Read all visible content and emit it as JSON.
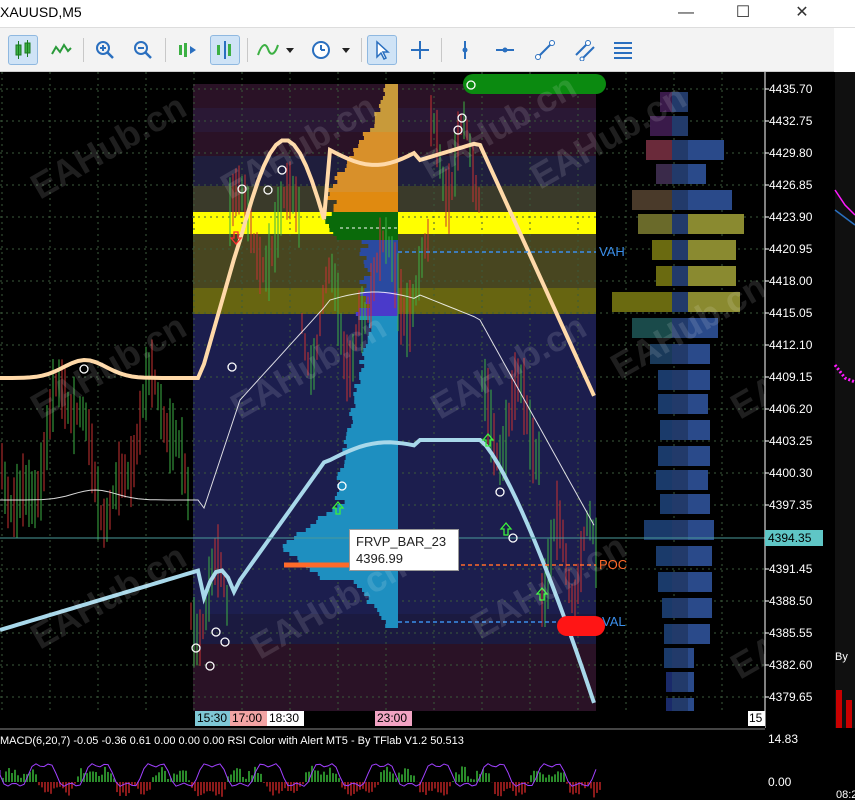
{
  "window": {
    "title": "XAUUSD,M5",
    "controls": {
      "minimize": "—",
      "maximize": "☐",
      "close": "✕"
    }
  },
  "toolbar": {
    "tools": [
      "bar-chart",
      "line-chart",
      "zoom-in",
      "zoom-out",
      "auto-scroll",
      "chart-shift",
      "indicators",
      "periods",
      "cursor",
      "crosshair",
      "vertical-line",
      "horizontal-line",
      "trend-line",
      "equidistant-channel",
      "fibonacci"
    ]
  },
  "price_axis": {
    "ticks": [
      "4435.70",
      "4432.75",
      "4429.80",
      "4426.85",
      "4423.90",
      "4420.95",
      "4418.00",
      "4415.05",
      "4412.10",
      "4409.15",
      "4406.20",
      "4403.25",
      "4400.30",
      "4397.35",
      "4394.35",
      "4391.45",
      "4388.50",
      "4385.55",
      "4382.60",
      "4379.65"
    ],
    "current_price": "4394.35",
    "macd_ticks": [
      "14.83",
      "0.00"
    ]
  },
  "time_axis": {
    "labels": [
      "15:30",
      "17:00",
      "18:30",
      "23:00"
    ],
    "right_label": "15",
    "far_right_label": "08:2"
  },
  "profile": {
    "name": "FRVP_BAR_23",
    "poc_value": "4396.99",
    "levels": {
      "vah": "VAH",
      "poc": "POC",
      "val": "VAL"
    }
  },
  "watermark": "EAHub.cn",
  "indicator_label": "MACD(6,20,7) -0.05 -0.36 0.61 0.00 0.00 0.00 RSI Color with Alert MT5 - By TFlab V1.2 50.513",
  "right_panel_label": "By",
  "colors": {
    "upper_band": "#ffd9a8",
    "lower_band": "#a8d8ea",
    "vah_line": "#3b8eea",
    "poc_line": "#ff6a2a",
    "value_area": "#ffff00",
    "profile_blue": "#1e8fc0",
    "profile_gold": "#d89a2a"
  }
}
